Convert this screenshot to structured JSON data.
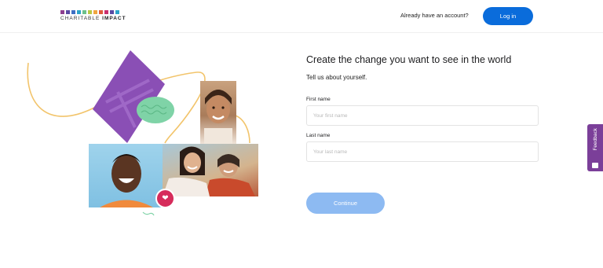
{
  "header": {
    "logo_plain": "CHARITABLE ",
    "logo_bold": "IMPACT",
    "logo_colors": [
      "#8e3f8f",
      "#5a4aa3",
      "#3f6fc3",
      "#2da4c9",
      "#6cc08b",
      "#b8c843",
      "#f0a640",
      "#e05a3c",
      "#c9306f",
      "#5a4aa3",
      "#2da4c9"
    ],
    "account_prompt": "Already have an account?",
    "login_label": "Log in"
  },
  "form": {
    "title": "Create the change you want to see in the world",
    "subtitle": "Tell us about yourself.",
    "first_name_label": "First name",
    "first_name_placeholder": "Your first name",
    "last_name_label": "Last name",
    "last_name_placeholder": "Your last name",
    "continue_label": "Continue"
  },
  "feedback": {
    "label": "Feedback"
  },
  "colors": {
    "accent": "#0a6cdb",
    "continue_disabled": "#8dbaf2",
    "feedback_tab": "#7b3f99"
  }
}
